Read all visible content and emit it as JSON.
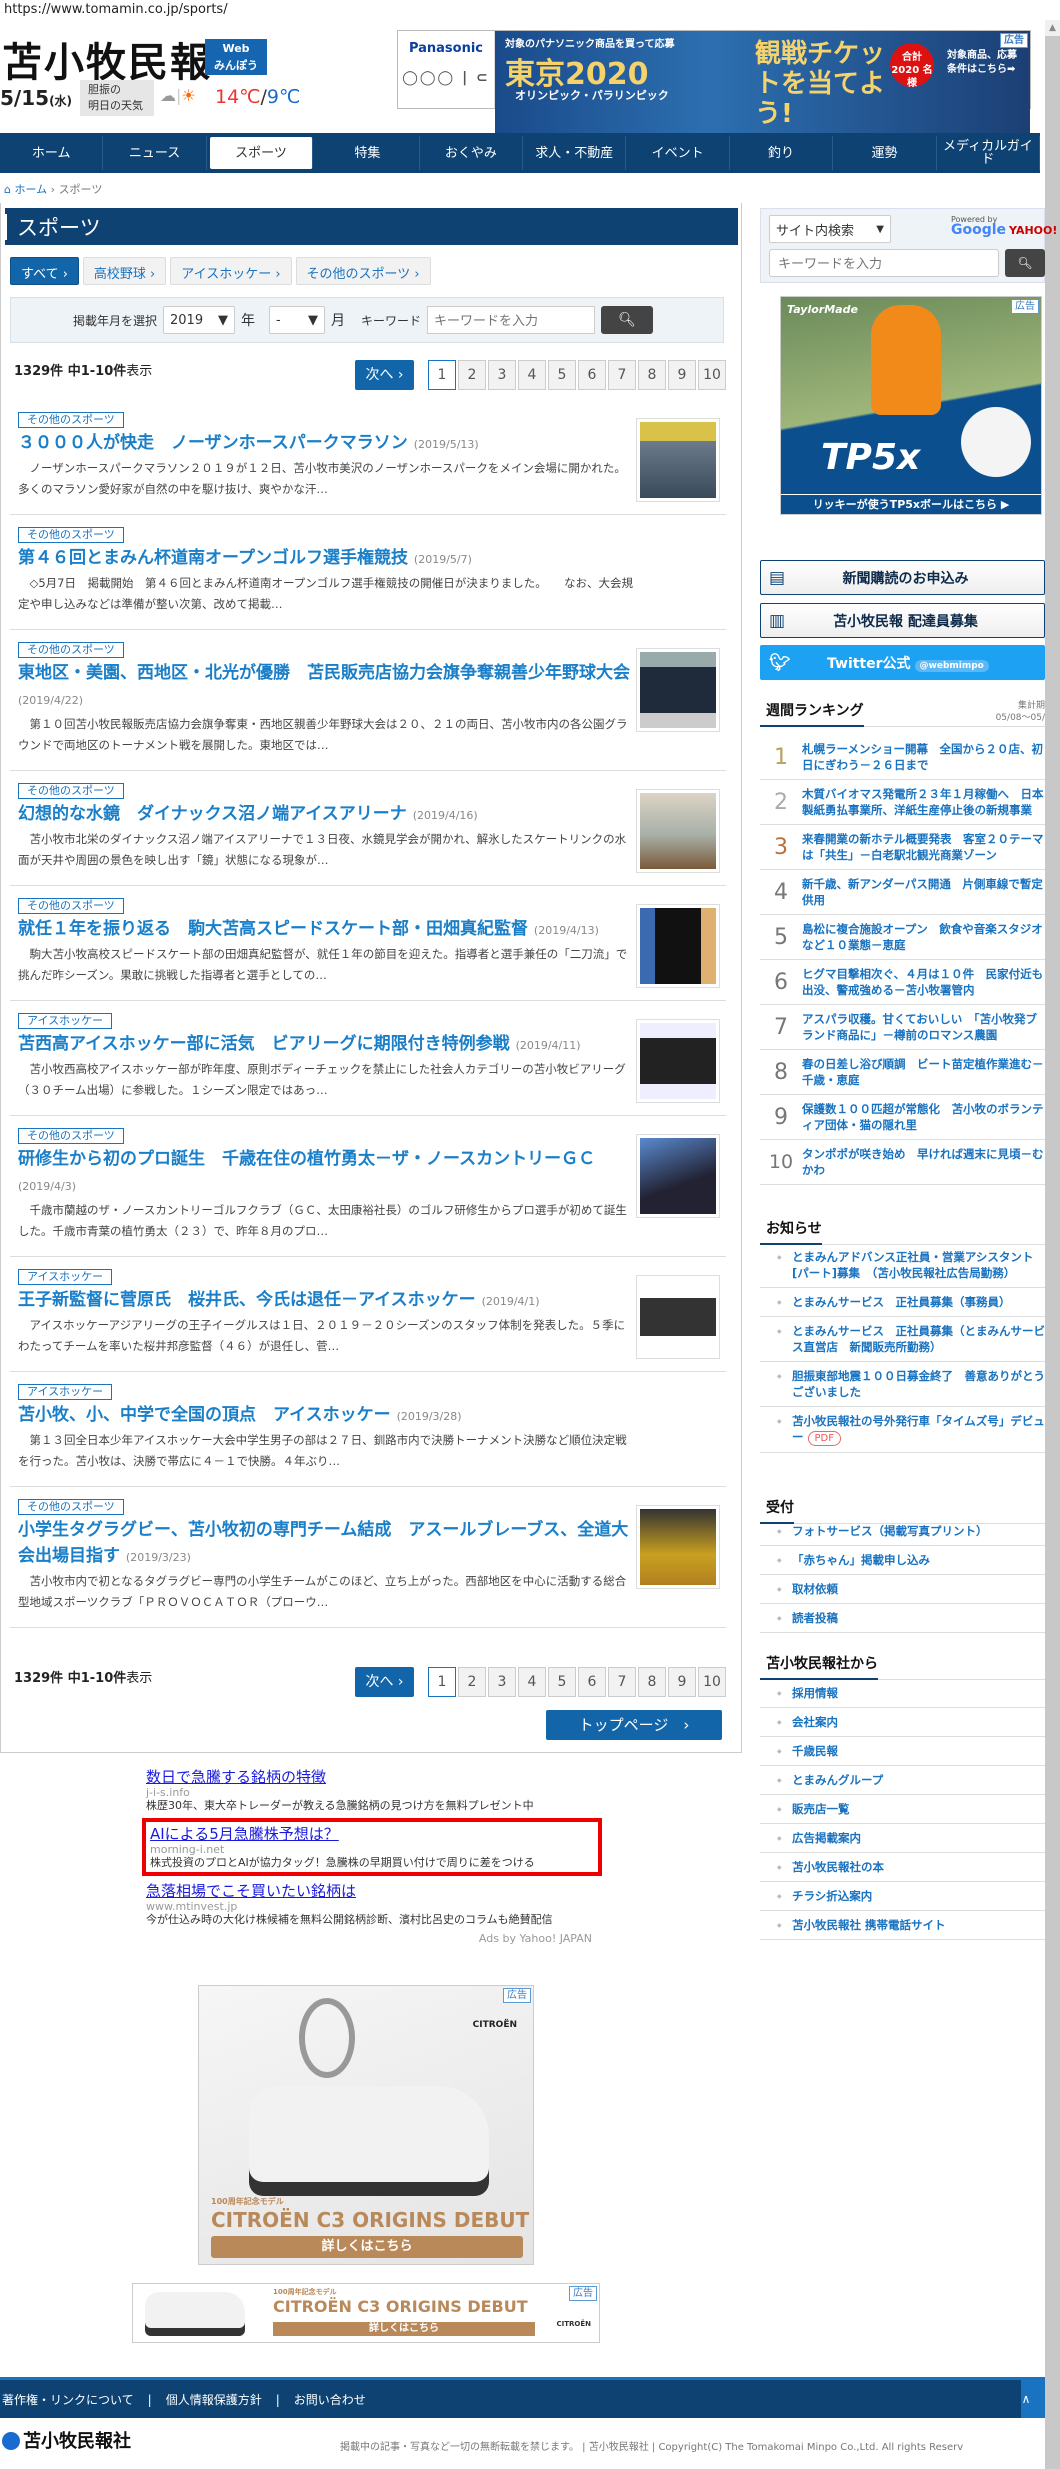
{
  "browser": {
    "url": "https://www.tomamin.co.jp/sports/"
  },
  "header": {
    "logo": "苫小牧民報",
    "web_badge": [
      "Web",
      "みんぽう"
    ],
    "date": "5/15",
    "weekday": "(水)",
    "weather_label": [
      "胆振の",
      "明日の天気"
    ],
    "temp_high": "14℃",
    "temp_low": "9℃",
    "temp_sep": "/"
  },
  "top_banner": {
    "brand": "Panasonic",
    "rings": "◯◯◯ | ⊂",
    "line1": "対象のパナソニック商品を買って応募",
    "line2": "東京2020",
    "line3": "オリンピック・パラリンピック",
    "line4": "観戦チケットを当てよう!",
    "badge": "合計 2020 名様",
    "cta": "対象商品、応募条件はこちら➡",
    "ad_label": "広告"
  },
  "nav": [
    "ホーム",
    "ニュース",
    "スポーツ",
    "特集",
    "おくやみ",
    "求人・不動産",
    "イベント",
    "釣り",
    "運勢",
    "メディカルガイド"
  ],
  "nav_active": 2,
  "breadcrumb": {
    "home": "ホーム",
    "sep": "›",
    "current": "スポーツ"
  },
  "page_title": "スポーツ",
  "categories": [
    "すべて ›",
    "高校野球 ›",
    "アイスホッケー ›",
    "その他のスポーツ ›"
  ],
  "filter": {
    "label": "掲載年月を選択",
    "year": "2019",
    "year_unit": "年",
    "month": "-",
    "month_unit": "月",
    "keyword_label": "キーワード",
    "keyword_placeholder": "キーワードを入力"
  },
  "results": {
    "total": "1329件",
    "range": "中1-10件",
    "suffix": "表示",
    "next": "次へ ›",
    "pages": [
      "1",
      "2",
      "3",
      "4",
      "5",
      "6",
      "7",
      "8",
      "9",
      "10"
    ],
    "current_page": "1"
  },
  "articles": [
    {
      "tag": "その他のスポーツ",
      "title": "３０００人が快走　ノーザンホースパークマラソン",
      "date": "(2019/5/13)",
      "excerpt": "ノーザンホースパークマラソン２０１９が１２日、苫小牧市美沢のノーザンホースパークをメイン会場に開かれた。多くのマラソン愛好家が自然の中を駆け抜け、爽やかな汗…",
      "thumb": true
    },
    {
      "tag": "その他のスポーツ",
      "title": "第４６回とまみん杯道南オープンゴルフ選手権競技",
      "date": "(2019/5/7)",
      "excerpt": "◇5月7日　掲載開始　第４６回とまみん杯道南オープンゴルフ選手権競技の開催日が決まりました。　　なお、大会規定や申し込みなどは準備が整い次第、改めて掲載…",
      "thumb": false
    },
    {
      "tag": "その他のスポーツ",
      "title": "東地区・美園、西地区・北光が優勝　苫民販売店協力会旗争奪親善少年野球大会",
      "date": "(2019/4/22)",
      "excerpt": "第１０回苫小牧民報販売店協力会旗争奪東・西地区親善少年野球大会は２０、２１の両日、苫小牧市内の各公園グラウンドで両地区のトーナメント戦を展開した。東地区では…",
      "thumb": true
    },
    {
      "tag": "その他のスポーツ",
      "title": "幻想的な水鏡　ダイナックス沼ノ端アイスアリーナ",
      "date": "(2019/4/16)",
      "excerpt": "苫小牧市北栄のダイナックス沼ノ端アイスアリーナで１３日夜、水鏡見学会が開かれ、解氷したスケートリンクの水面が天井や周囲の景色を映し出す「鏡」状態になる現象が…",
      "thumb": true
    },
    {
      "tag": "その他のスポーツ",
      "title": "就任１年を振り返る　駒大苫高スピードスケート部・田畑真紀監督",
      "date": "(2019/4/13)",
      "excerpt": "駒大苫小牧高校スピードスケート部の田畑真紀監督が、就任１年の節目を迎えた。指導者と選手兼任の「二刀流」で挑んだ昨シーズン。果敢に挑戦した指導者と選手としての…",
      "thumb": true
    },
    {
      "tag": "アイスホッケー",
      "title": "苫西高アイスホッケー部に活気　ビアリーグに期限付き特例参戦",
      "date": "(2019/4/11)",
      "excerpt": "苫小牧西高校アイスホッケー部が昨年度、原則ボディーチェックを禁止にした社会人カテゴリーの苫小牧ビアリーグ（３０チーム出場）に参戦した。１シーズン限定ではあっ…",
      "thumb": true
    },
    {
      "tag": "その他のスポーツ",
      "title": "研修生から初のプロ誕生　千歳在住の植竹勇太－ザ・ノースカントリーＧＣ",
      "date": "(2019/4/3)",
      "excerpt": "千歳市蘭越のザ・ノースカントリーゴルフクラブ（ＧＣ、太田康裕社長）のゴルフ研修生からプロ選手が初めて誕生した。千歳市青葉の植竹勇太（２３）で、昨年８月のプロ…",
      "thumb": true
    },
    {
      "tag": "アイスホッケー",
      "title": "王子新監督に菅原氏　桜井氏、今氏は退任－アイスホッケー",
      "date": "(2019/4/1)",
      "excerpt": "アイスホッケーアジアリーグの王子イーグルスは１日、２０１９－２０シーズンのスタッフ体制を発表した。５季にわたってチームを率いた桜井邦彦監督（４６）が退任し、菅…",
      "thumb": true
    },
    {
      "tag": "アイスホッケー",
      "title": "苫小牧、小、中学で全国の頂点　アイスホッケー",
      "date": "(2019/3/28)",
      "excerpt": "第１３回全日本少年アイスホッケー大会中学生男子の部は２７日、釧路市内で決勝トーナメント決勝など順位決定戦を行った。苫小牧は、決勝で帯広に４－１で快勝。４年ぶり…",
      "thumb": false
    },
    {
      "tag": "その他のスポーツ",
      "title": "小学生タグラグビー、苫小牧初の専門チーム結成　アスールブレーブス、全道大会出場目指す",
      "date": "(2019/3/23)",
      "excerpt": "苫小牧市内で初となるタグラグビー専門の小学生チームがこのほど、立ち上がった。西部地区を中心に活動する総合型地域スポーツクラブ「ＰＲＯＶＯＣＡＴＯＲ（プローウ…",
      "thumb": true
    }
  ],
  "top_page": "トップページ　›",
  "text_ads": [
    {
      "headline": "数日で急騰する銘柄の特徴",
      "domain": "j-i-s.info",
      "desc": "株歴30年、東大卒トレーダーが教える急騰銘柄の見つけ方を無料プレゼント中"
    },
    {
      "headline": "AIによる5月急騰株予想は？",
      "domain": "morning-i.net",
      "desc": "株式投資のプロとAIが協力タッグ！急騰株の早期買い付けで周りに差をつける"
    },
    {
      "headline": "急落相場でこそ買いたい銘柄は",
      "domain": "www.mtinvest.jp",
      "desc": "今が仕込み時の大化け株候補を無料公開銘柄診断、濱村比呂史のコラムも絶賛配信"
    }
  ],
  "ads_by": "Ads by Yahoo! JAPAN",
  "citroen_ad": {
    "sub": "100周年記念モデル",
    "headline": "CITROËN C3 ORIGINS DEBUT",
    "cta": "詳しくはこちら",
    "brand": "CITROËN",
    "ad_label": "広告"
  },
  "footer": {
    "links": [
      "著作権・リンクについて",
      "|",
      "個人情報保護方針",
      "|",
      "お問い合わせ"
    ],
    "logo": "苫小牧民報社",
    "copyright": "掲載中の記事・写真など一切の無断転載を禁じます。 | 苫小牧民報社 | Copyright(C) The Tomakomai Minpo Co.,Ltd. All rights Reserv"
  },
  "sidebar": {
    "search_scope": "サイト内検索",
    "powered_by": "Powered by",
    "google": "Google",
    "yahoo": "YAHOO!",
    "keyword_placeholder": "キーワードを入力",
    "golf_ad": {
      "brand": "TaylorMade",
      "product": "TP5x",
      "cta": "リッキーが使うTP5xボールはこちら ▶",
      "ad_label": "広告"
    },
    "subscribe": "新聞購読のお申込み",
    "carrier": "苫小牧民報 配達員募集",
    "twitter": "Twitter公式",
    "twitter_handle": "@webmimpo",
    "ranking_title": "週間ランキング",
    "ranking_period_label": "集計期",
    "ranking_period": "05/08〜05/",
    "ranking": [
      "札幌ラーメンショー開幕　全国から２０店、初日にぎわう－２６日まで",
      "木質バイオマス発電所２３年１月稼働へ　日本製紙勇払事業所、洋紙生産停止後の新規事業",
      "来春開業の新ホテル概要発表　客室２０テーマは「共生」－白老駅北観光商業ゾーン",
      "新千歳、新アンダーパス開通　片側車線で暫定供用",
      "島松に複合施設オープン　飲食や音楽スタジオなど１０業態－恵庭",
      "ヒグマ目撃相次ぐ、４月は１０件　民家付近も出没、警戒強める－苫小牧署管内",
      "アスパラ収穫。甘くておいしい　「苫小牧発ブランド商品に」－樽前のロマンス農園",
      "春の日差し浴び順調　ビート苗定植作業進む－千歳・恵庭",
      "保護数１００匹超が常態化　苫小牧のボランティア団体・猫の隠れ里",
      "タンポポが咲き始め　早ければ週末に見頃－むかわ"
    ],
    "news_title": "お知らせ",
    "news": [
      "とまみんアドバンス正社員・営業アシスタント[パート]募集　（苫小牧民報社広告局勤務）",
      "とまみんサービス　正社員募集（事務員）",
      "とまみんサービス　正社員募集（とまみんサービス直営店　新聞販売所勤務）",
      "胆振東部地震１００日募金終了　善意ありがとうございました",
      "苫小牧民報社の号外発行車「タイムズ号」デビュー"
    ],
    "pdf": "PDF",
    "reception_title": "受付",
    "reception": [
      "フォトサービス（掲載写真プリント）",
      "「赤ちゃん」掲載申し込み",
      "取材依頼",
      "読者投稿"
    ],
    "company_title": "苫小牧民報社から",
    "company": [
      "採用情報",
      "会社案内",
      "千歳民報",
      "とまみんグループ",
      "販売店一覧",
      "広告掲載案内",
      "苫小牧民報社の本",
      "チラシ折込案内",
      "苫小牧民報社 携帯電話サイト"
    ]
  }
}
